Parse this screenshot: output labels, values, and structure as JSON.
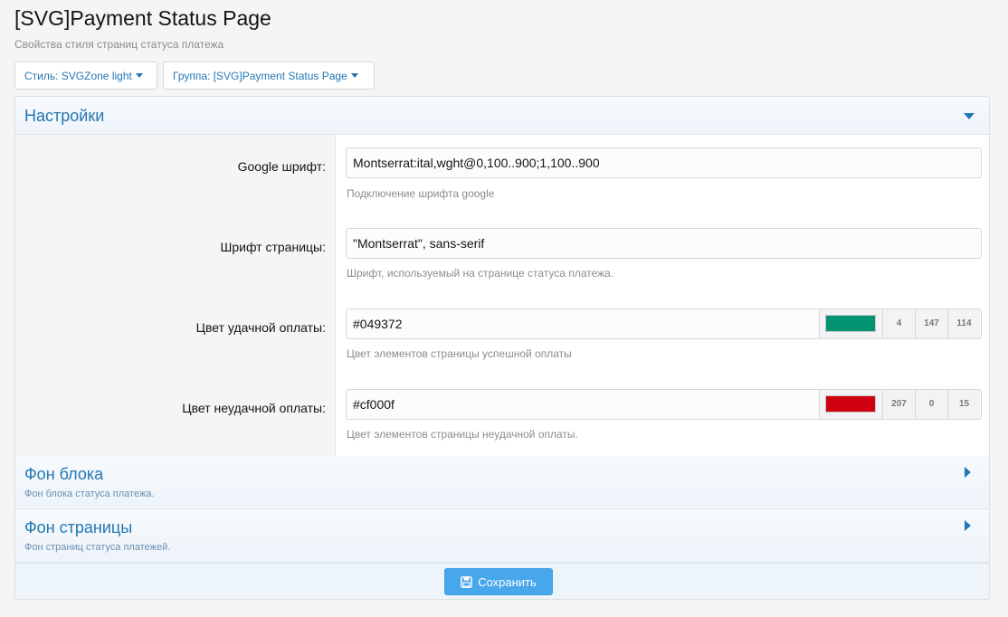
{
  "page": {
    "title": "[SVG]Payment Status Page",
    "description": "Свойства стиля страниц статуса платежа"
  },
  "choosers": {
    "style": "Стиль: SVGZone light",
    "group": "Группа: [SVG]Payment Status Page"
  },
  "sections": {
    "settings": {
      "title": "Настройки"
    },
    "block_bg": {
      "title": "Фон блока",
      "description": "Фон блока статуса платежа."
    },
    "page_bg": {
      "title": "Фон страницы",
      "description": "Фон страниц статуса платежей."
    }
  },
  "settings": [
    {
      "label": "Google шрифт:",
      "value": "Montserrat:ital,wght@0,100..900;1,100..900",
      "hint": "Подключение шрифта google"
    },
    {
      "label": "Шрифт страницы:",
      "value": "\"Montserrat\", sans-serif",
      "hint": "Шрифт, используемый на странице статуса платежа."
    },
    {
      "label": "Цвет удачной оплаты:",
      "value": "#049372",
      "hint": "Цвет элементов страницы успешной оплаты",
      "color": "#049372",
      "r": "4",
      "g": "147",
      "b": "114"
    },
    {
      "label": "Цвет неудачной оплаты:",
      "value": "#cf000f",
      "hint": "Цвет элементов страницы неудачной оплаты.",
      "color": "#cf000f",
      "r": "207",
      "g": "0",
      "b": "15"
    }
  ],
  "footer": {
    "save_label": "Сохранить"
  },
  "icons": {
    "settings_toggle": "caret-down-icon",
    "collapsed": "caret-right-icon",
    "save": "floppy-disk-icon"
  }
}
